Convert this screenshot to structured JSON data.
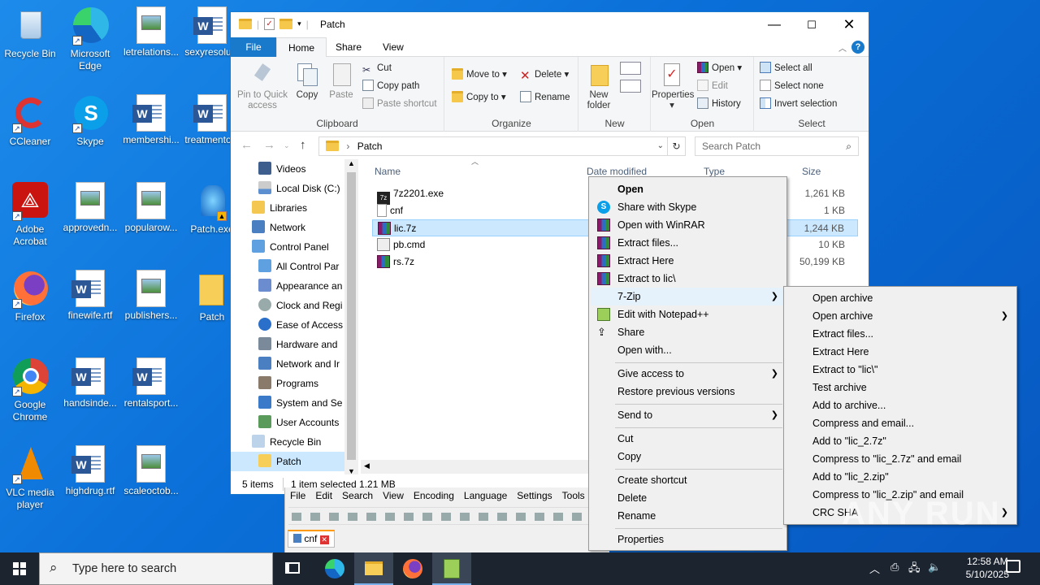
{
  "desktop": {
    "icons": [
      {
        "label": "Recycle Bin"
      },
      {
        "label": "Microsoft Edge"
      },
      {
        "label": "letrelations..."
      },
      {
        "label": "sexyresolu..."
      },
      {
        "label": "CCleaner"
      },
      {
        "label": "Skype"
      },
      {
        "label": "membershi..."
      },
      {
        "label": "treatmento..."
      },
      {
        "label": "Adobe Acrobat"
      },
      {
        "label": "approvedn..."
      },
      {
        "label": "popularow..."
      },
      {
        "label": "Patch.exe"
      },
      {
        "label": "Firefox"
      },
      {
        "label": "finewife.rtf"
      },
      {
        "label": "publishers..."
      },
      {
        "label": "Patch"
      },
      {
        "label": "Google Chrome"
      },
      {
        "label": "handsinde..."
      },
      {
        "label": "rentalsport..."
      },
      {
        "label": "VLC media player"
      },
      {
        "label": "highdrug.rtf"
      },
      {
        "label": "scaleoctob..."
      }
    ]
  },
  "explorer": {
    "title": "Patch",
    "tabs": {
      "file": "File",
      "home": "Home",
      "share": "Share",
      "view": "View"
    },
    "ribbon": {
      "clipboard": {
        "pin": "Pin to Quick access",
        "copy": "Copy",
        "paste": "Paste",
        "cut": "Cut",
        "copy_path": "Copy path",
        "paste_shortcut": "Paste shortcut",
        "group": "Clipboard"
      },
      "organize": {
        "move_to": "Move to",
        "copy_to": "Copy to",
        "delete": "Delete",
        "rename": "Rename",
        "group": "Organize"
      },
      "new": {
        "new_folder": "New folder",
        "group": "New"
      },
      "open": {
        "properties": "Properties",
        "open": "Open",
        "edit": "Edit",
        "history": "History",
        "group": "Open"
      },
      "select": {
        "select_all": "Select all",
        "select_none": "Select none",
        "invert": "Invert selection",
        "group": "Select"
      }
    },
    "address": {
      "path": "Patch",
      "search_placeholder": "Search Patch"
    },
    "nav": [
      {
        "label": "Videos"
      },
      {
        "label": "Local Disk (C:)"
      },
      {
        "label": "Libraries"
      },
      {
        "label": "Network"
      },
      {
        "label": "Control Panel"
      },
      {
        "label": "All Control Par"
      },
      {
        "label": "Appearance an"
      },
      {
        "label": "Clock and Regi"
      },
      {
        "label": "Ease of Access"
      },
      {
        "label": "Hardware and"
      },
      {
        "label": "Network and Ir"
      },
      {
        "label": "Programs"
      },
      {
        "label": "System and Se"
      },
      {
        "label": "User Accounts"
      },
      {
        "label": "Recycle Bin"
      },
      {
        "label": "Patch"
      }
    ],
    "columns": {
      "name": "Name",
      "date": "Date modified",
      "type": "Type",
      "size": "Size"
    },
    "files": [
      {
        "name": "7z2201.exe",
        "size": "1,261 KB"
      },
      {
        "name": "cnf",
        "size": "1 KB"
      },
      {
        "name": "lic.7z",
        "size": "1,244 KB"
      },
      {
        "name": "pb.cmd",
        "size": "10 KB"
      },
      {
        "name": "rs.7z",
        "size": "50,199 KB"
      }
    ],
    "status": {
      "count": "5 items",
      "selected": "1 item selected  1.21 MB"
    }
  },
  "notepadpp": {
    "menu": [
      "File",
      "Edit",
      "Search",
      "View",
      "Encoding",
      "Language",
      "Settings",
      "Tools"
    ],
    "tab": "cnf"
  },
  "context_menu": {
    "items": [
      "Open",
      "Share with Skype",
      "Open with WinRAR",
      "Extract files...",
      "Extract Here",
      "Extract to lic\\",
      "7-Zip",
      "Edit with Notepad++",
      "Share",
      "Open with...",
      "Give access to",
      "Restore previous versions",
      "Send to",
      "Cut",
      "Copy",
      "Create shortcut",
      "Delete",
      "Rename",
      "Properties"
    ]
  },
  "submenu_7zip": {
    "items": [
      "Open archive",
      "Open archive",
      "Extract files...",
      "Extract Here",
      "Extract to \"lic\\\"",
      "Test archive",
      "Add to archive...",
      "Compress and email...",
      "Add to \"lic_2.7z\"",
      "Compress to \"lic_2.7z\" and email",
      "Add to \"lic_2.zip\"",
      "Compress to \"lic_2.zip\" and email",
      "CRC SHA"
    ]
  },
  "taskbar": {
    "search_placeholder": "Type here to search",
    "time": "12:58 AM",
    "date": "5/10/2025"
  },
  "watermark": "ANY RUN"
}
